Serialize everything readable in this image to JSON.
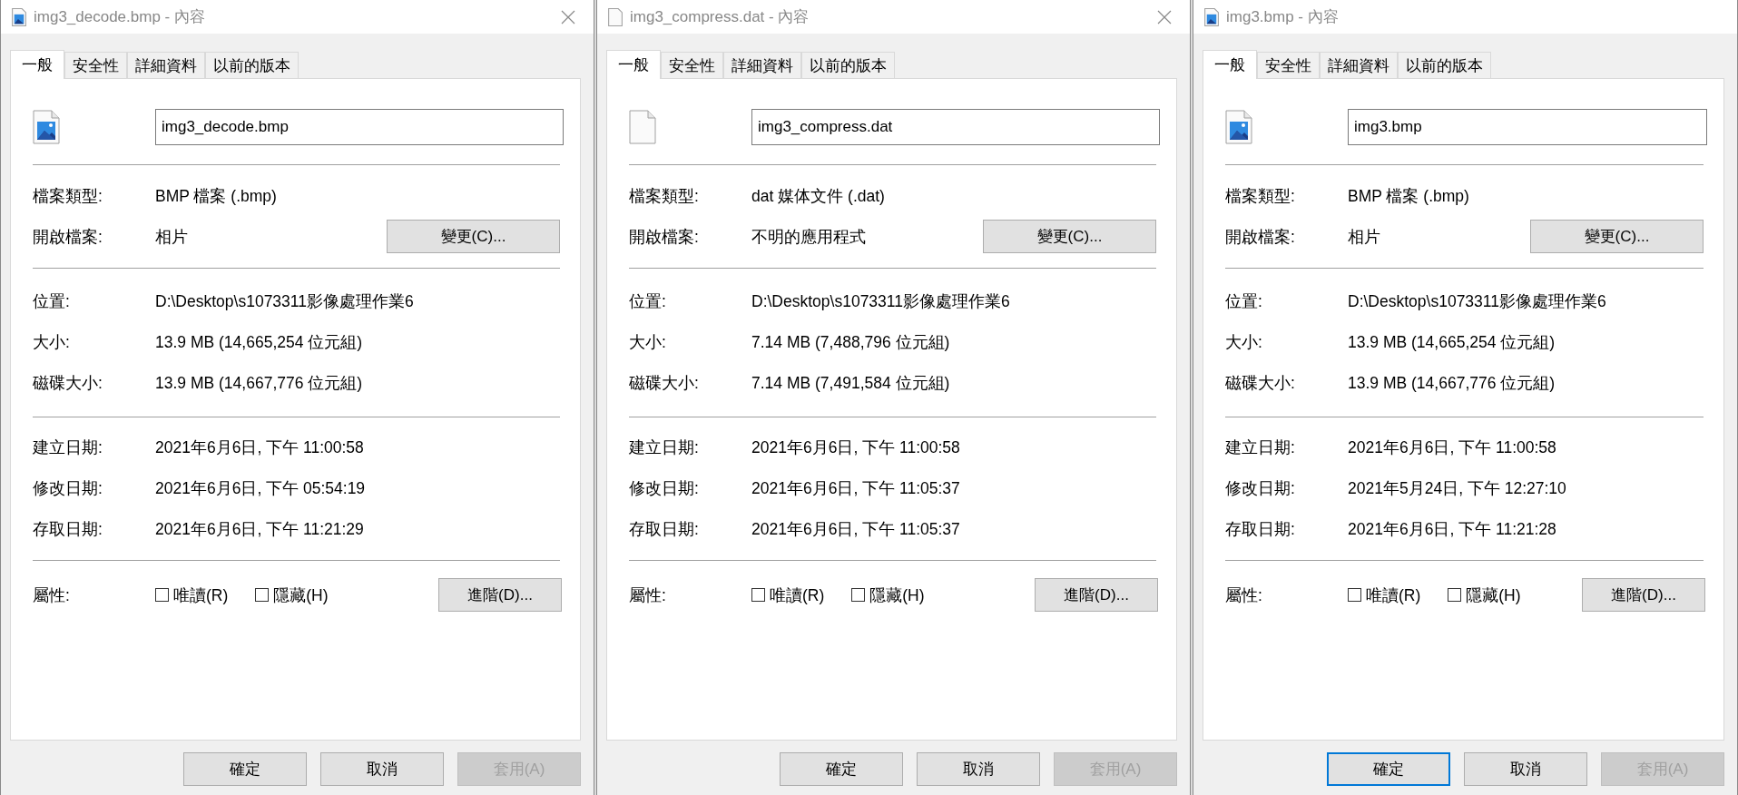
{
  "windows": [
    {
      "title": "img3_decode.bmp - 內容",
      "show_close": true,
      "tabs": [
        {
          "label": "一般",
          "selected": true
        },
        {
          "label": "安全性",
          "selected": false
        },
        {
          "label": "詳細資料",
          "selected": false
        },
        {
          "label": "以前的版本",
          "selected": false
        }
      ],
      "file": {
        "kind": "image",
        "name": "img3_decode.bmp"
      },
      "type_row": {
        "label": "檔案類型:",
        "value": "BMP 檔案 (.bmp)"
      },
      "opens_with": {
        "label": "開啟檔案:",
        "value": "相片",
        "button": "變更(C)..."
      },
      "location_rows": [
        {
          "label": "位置:",
          "value": "D:\\Desktop\\s1073311影像處理作業6"
        },
        {
          "label": "大小:",
          "value": "13.9 MB (14,665,254 位元組)"
        },
        {
          "label": "磁碟大小:",
          "value": "13.9 MB (14,667,776 位元組)"
        }
      ],
      "date_rows": [
        {
          "label": "建立日期:",
          "value": "2021年6月6日, 下午 11:00:58"
        },
        {
          "label": "修改日期:",
          "value": "2021年6月6日, 下午 05:54:19"
        },
        {
          "label": "存取日期:",
          "value": "2021年6月6日, 下午 11:21:29"
        }
      ],
      "attributes": {
        "label": "屬性:",
        "checkboxes": [
          {
            "label": "唯讀(R)",
            "checked": false
          },
          {
            "label": "隱藏(H)",
            "checked": false
          }
        ],
        "button": "進階(D)..."
      },
      "buttons": [
        {
          "label": "確定",
          "focused": false,
          "disabled": false
        },
        {
          "label": "取消",
          "focused": false,
          "disabled": false
        },
        {
          "label": "套用(A)",
          "focused": false,
          "disabled": true
        }
      ]
    },
    {
      "title": "img3_compress.dat - 內容",
      "show_close": true,
      "tabs": [
        {
          "label": "一般",
          "selected": true
        },
        {
          "label": "安全性",
          "selected": false
        },
        {
          "label": "詳細資料",
          "selected": false
        },
        {
          "label": "以前的版本",
          "selected": false
        }
      ],
      "file": {
        "kind": "blank",
        "name": "img3_compress.dat"
      },
      "type_row": {
        "label": "檔案類型:",
        "value": "dat 媒体文件 (.dat)"
      },
      "opens_with": {
        "label": "開啟檔案:",
        "value": "不明的應用程式",
        "button": "變更(C)..."
      },
      "location_rows": [
        {
          "label": "位置:",
          "value": "D:\\Desktop\\s1073311影像處理作業6"
        },
        {
          "label": "大小:",
          "value": "7.14 MB (7,488,796 位元組)"
        },
        {
          "label": "磁碟大小:",
          "value": "7.14 MB (7,491,584 位元組)"
        }
      ],
      "date_rows": [
        {
          "label": "建立日期:",
          "value": "2021年6月6日, 下午 11:00:58"
        },
        {
          "label": "修改日期:",
          "value": "2021年6月6日, 下午 11:05:37"
        },
        {
          "label": "存取日期:",
          "value": "2021年6月6日, 下午 11:05:37"
        }
      ],
      "attributes": {
        "label": "屬性:",
        "checkboxes": [
          {
            "label": "唯讀(R)",
            "checked": false
          },
          {
            "label": "隱藏(H)",
            "checked": false
          }
        ],
        "button": "進階(D)..."
      },
      "buttons": [
        {
          "label": "確定",
          "focused": false,
          "disabled": false
        },
        {
          "label": "取消",
          "focused": false,
          "disabled": false
        },
        {
          "label": "套用(A)",
          "focused": false,
          "disabled": true
        }
      ]
    },
    {
      "title": "img3.bmp - 內容",
      "show_close": false,
      "tabs": [
        {
          "label": "一般",
          "selected": true
        },
        {
          "label": "安全性",
          "selected": false
        },
        {
          "label": "詳細資料",
          "selected": false
        },
        {
          "label": "以前的版本",
          "selected": false
        }
      ],
      "file": {
        "kind": "image",
        "name": "img3.bmp"
      },
      "type_row": {
        "label": "檔案類型:",
        "value": "BMP 檔案 (.bmp)"
      },
      "opens_with": {
        "label": "開啟檔案:",
        "value": "相片",
        "button": "變更(C)..."
      },
      "location_rows": [
        {
          "label": "位置:",
          "value": "D:\\Desktop\\s1073311影像處理作業6"
        },
        {
          "label": "大小:",
          "value": "13.9 MB (14,665,254 位元組)"
        },
        {
          "label": "磁碟大小:",
          "value": "13.9 MB (14,667,776 位元組)"
        }
      ],
      "date_rows": [
        {
          "label": "建立日期:",
          "value": "2021年6月6日, 下午 11:00:58"
        },
        {
          "label": "修改日期:",
          "value": "2021年5月24日, 下午 12:27:10"
        },
        {
          "label": "存取日期:",
          "value": "2021年6月6日, 下午 11:21:28"
        }
      ],
      "attributes": {
        "label": "屬性:",
        "checkboxes": [
          {
            "label": "唯讀(R)",
            "checked": false
          },
          {
            "label": "隱藏(H)",
            "checked": false
          }
        ],
        "button": "進階(D)..."
      },
      "buttons": [
        {
          "label": "確定",
          "focused": true,
          "disabled": false
        },
        {
          "label": "取消",
          "focused": false,
          "disabled": false
        },
        {
          "label": "套用(A)",
          "focused": false,
          "disabled": true
        }
      ]
    }
  ]
}
